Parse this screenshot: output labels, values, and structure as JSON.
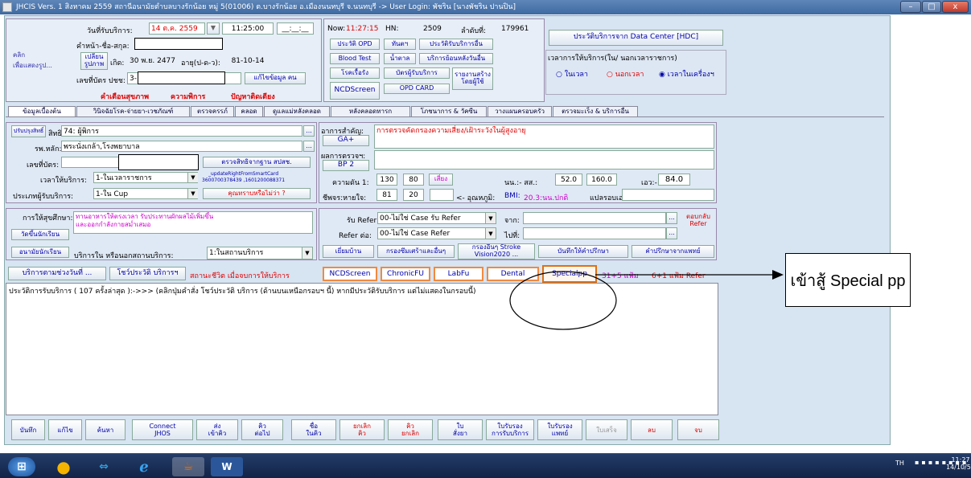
{
  "window": {
    "title": "JHCIS Vers. 1 สิงหาคม 2559 สถานีอนามัยตำบลบางรักน้อย หมู่ 5(01006) ต.บางรักน้อย อ.เมืองนนทบุรี จ.นนทบุรี -> User Login: พัชริน  [นางพัชริน  ปานปิน]",
    "minimize": "–",
    "maximize": "□",
    "close": "x"
  },
  "header": {
    "photo_hint": "คลิก\nเพื่อแสดงรูป...",
    "service_date_label": "วันที่รับบริการ:",
    "service_date": "14 ต.ค. 2559",
    "service_time": "11:25:00",
    "end_time": "__:__:__",
    "prefix_label": "คำหน้า-ชื่อ-สกุล:",
    "change_photo_btn": "เปลี่ยนรูปภาพ",
    "birth_label": "เกิด:",
    "birth_value": "30 พ.ย. 2477",
    "age_label": "อายุ(ป-ด-ว):",
    "age_value": "81-10-14",
    "id_label": "เลขที่บัตร ปชช:",
    "id_value": "3-",
    "edit_person_btn": "แก้ไขข้อมูล คน",
    "alert_link": "คำเตือนสุขภาพ",
    "disability_link": "ความพิการ",
    "risk_link": "ปัญหาติดเตียง",
    "now_label": "Now:",
    "now_time": "11:27:15",
    "hn_label": "HN:",
    "hn_value": "2509",
    "seq_label": "ลำดับที่:",
    "seq_value": "179961",
    "btn_opd_history": "ประวัติ OPD",
    "btn_dental": "ทันตฯ",
    "btn_other_history": "ประวัติรับบริการอื่น",
    "btn_blood_test": "Blood Test",
    "btn_sugar": "น้ำตาล",
    "btn_backdate": "บริการย้อนหลังวันอื่น",
    "btn_chronic": "โรคเรื้อรัง",
    "btn_card_service": "บัตรผู้รับบริการ",
    "btn_report": "รายงานสร้างโดยผู้ใช้",
    "btn_ncd": "NCDScreen",
    "btn_opd_card": "OPD CARD",
    "hdc_btn": "ประวัติบริการจาก Data Center [HDC]",
    "time_group_label": "เวลาการให้บริการ(ใน/ นอกเวลาราชการ)",
    "radio_in": "ในเวลา",
    "radio_out": "นอกเวลา",
    "radio_machine": "เวลาในเครื่องฯ"
  },
  "tabs": [
    "ข้อมูลเบื้องต้น",
    "วินิจฉัยโรค-จ่ายยา-เวชภัณฑ์",
    "ตรวจครรภ์",
    "คลอด",
    "ดูแลแม่หลังคลอด",
    "หลังคลอดทารก",
    "โภชนาการ & วัคซีน",
    "วางแผนครอบครัว",
    "ตรวจมะเร็ง & บริการอื่น"
  ],
  "rights": {
    "update_btn": "ปรับปรุงสิทธิ์",
    "right_label": "สิทธิ:",
    "right_value": "74: ผู้พิการ",
    "main_hosp_label": "รพ.หลัก:",
    "main_hosp_value": "พระนั่งเกล้า,โรงพยาบาล",
    "card_label": "เลขที่บัตร:",
    "check_right_btn": "ตรวจสิทธิจากฐาน สปสช.",
    "service_time_label": "เวลาให้บริการ:",
    "service_time_value": "1-ในเวลาราชการ",
    "smartcard_text": "_updateRightFromSmartCard\n3600700378439 ,1601200088371",
    "type_label": "ประเภทผู้รับบริการ:",
    "type_value": "1-ใน Cup",
    "know_btn": "คุณทราบหรือไม่ว่า ?"
  },
  "vitals": {
    "symptom_label": "อาการสำคัญ:",
    "symptom_value": "การตรวจคัดกรองความเสี่ยง/เฝ้าระวังในผู้สูงอายุ",
    "ga_btn": "GA+",
    "exam_label": "ผลการตรวจฯ:",
    "bp2_btn": "BP 2",
    "bp_label": "ความดัน 1:",
    "bp_sys": "130",
    "bp_dia": "80",
    "risk_btn": "เสี่ยง",
    "weight_label": "นน.:- สส.:",
    "weight": "52.0",
    "height": "160.0",
    "waist_label": "เอว:-",
    "waist": "84.0",
    "pulse_label": "ชีพจร:หายใจ:",
    "pulse": "81",
    "resp": "20",
    "temp_label": "<- อุณหภูมิ:",
    "bmi_label": "BMI:",
    "bmi_value": "20.3:นน.ปกติ",
    "interpret_label": "แปลรอบเอว:"
  },
  "advice": {
    "advice_label": "การให้สุขศึกษา:",
    "advice_text": "ทานอาหารให้ตรงเวลา รับประทานผักผลไม้เพิ่มขึ้น\nและออกกำลังกายสม่ำเสมอ",
    "student_btn": "วัดขึ้นนักเรียน",
    "school_btn": "อนามัยนักเรียน",
    "place_label": "บริการใน หรือนอกสถานบริการ:",
    "place_value": "1:ในสถานบริการ"
  },
  "refer": {
    "refer_in_label": "รับ Refer:",
    "refer_in_value": "00-ไม่ใช่ Case รับ Refer",
    "from_label": "จาก:",
    "refer_out_label": "Refer ต่อ:",
    "refer_out_value": "00-ไม่ใช่ Case Refer",
    "to_label": "ไปที่:",
    "reply_btn": "ตอบกลับ Refer",
    "home_visit_btn": "เยี่ยมบ้าน",
    "depression_btn": "กรองซึมเศร้าและอื่นๆ",
    "stroke_btn": "กรองอื่นๆ Stroke Vision2020 ...",
    "consult_btn": "บันทึกให้คำปรึกษา",
    "doctor_consult_btn": "คำปรึกษาจากแพทย์"
  },
  "history_bar": {
    "period_btn": "บริการตามช่วงวันที่ ...",
    "show_history_btn": "โชว์ประวัติ บริการฯ",
    "status_text": "สถานะชีวิต เมื่อจบการให้บริการ",
    "ncd_btn": "NCDScreen",
    "chronicfu_btn": "ChronicFU",
    "labfu_btn": "LabFu",
    "dental_btn": "Dental",
    "specialpp_btn": "Specialpp",
    "count1": "31+5 แฟ้ม",
    "count2": "6+1 แฟ้ม Refer"
  },
  "history_text": "ประวัติการรับบริการ ( 107 ครั้งล่าสุด ):->>> (คลิกปุ่มคำสั่ง โชว์ประวัติ บริการ (ด้านบนเหนือกรอบฯ นี้) หากมีประวัติรับบริการ แต่ไม่แสดงในกรอบนี้)",
  "annotation": "เข้าสู้ Special pp",
  "bottom_buttons": [
    "บันทึก",
    "แก้ไข",
    "ค้นหา",
    "Connect\nJHOS",
    "ส่ง\nเข้าคิว",
    "คิว\nต่อไป",
    "ชื่อ\nในคิว",
    "ยกเลิก\nคิว",
    "คิว\nยกเลิก",
    "ใบ\nสั่งยา",
    "ใบรับรอง\nการรับบริการ",
    "ใบรับรอง\nแพทย์",
    "ใบเสร็จ",
    "ลบ",
    "จบ"
  ],
  "taskbar": {
    "lang": "TH",
    "time": "11:27",
    "date": "14/10/59"
  },
  "colors": {
    "accent": "#00a",
    "alert": "#d00",
    "orange_border": "#f08a40"
  }
}
